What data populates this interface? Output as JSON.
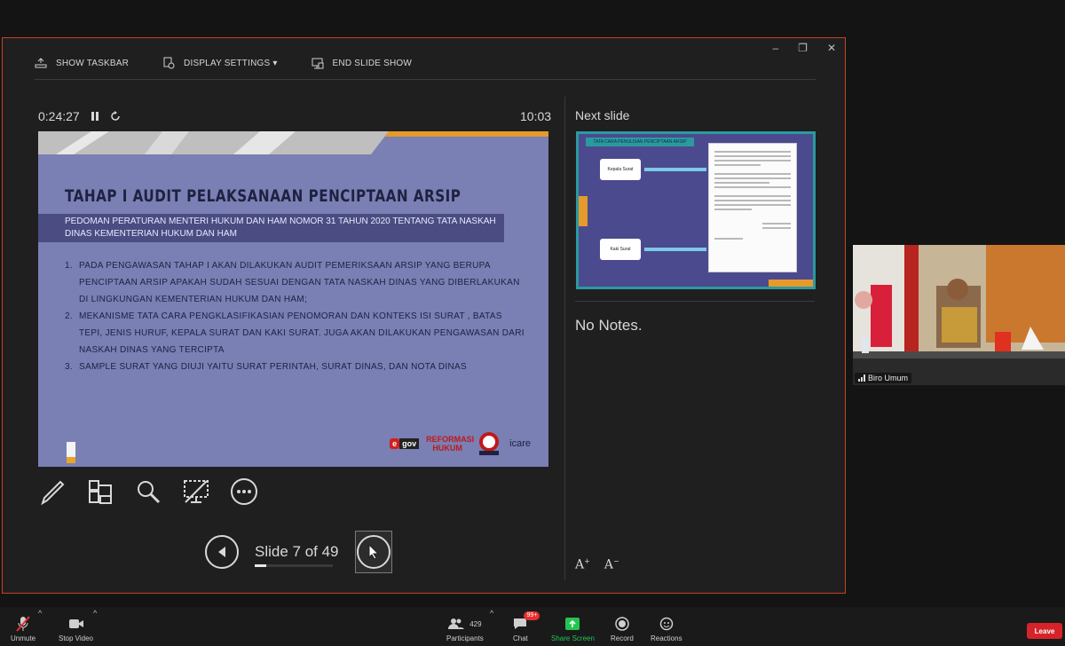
{
  "toolbar": {
    "show_taskbar": "SHOW TASKBAR",
    "display_settings": "DISPLAY SETTINGS ▾",
    "end_slide_show": "END SLIDE SHOW"
  },
  "window_controls": {
    "minimize": "–",
    "restore": "❐",
    "close": "✕"
  },
  "timer": {
    "elapsed": "0:24:27",
    "clock": "10:03"
  },
  "slide": {
    "title": "TAHAP I AUDIT PELAKSANAAN PENCIPTAAN ARSIP",
    "subtitle": "PEDOMAN PERATURAN MENTERI HUKUM DAN HAM NOMOR 31 TAHUN 2020 TENTANG TATA NASKAH DINAS KEMENTERIAN HUKUM DAN HAM",
    "items": [
      {
        "num": "1.",
        "text": "PADA PENGAWASAN TAHAP I AKAN DILAKUKAN AUDIT PEMERIKSAAN ARSIP YANG BERUPA PENCIPTAAN ARSIP APAKAH SUDAH SESUAI DENGAN TATA NASKAH DINAS YANG DIBERLAKUKAN DI LINGKUNGAN KEMENTERIAN HUKUM DAN HAM;"
      },
      {
        "num": "2.",
        "text": "MEKANISME TATA CARA PENGKLASIFIKASIAN PENOMORAN DAN KONTEKS ISI SURAT , BATAS TEPI, JENIS HURUF, KEPALA SURAT DAN KAKI SURAT. JUGA AKAN DILAKUKAN PENGAWASAN DARI NASKAH DINAS YANG TERCIPTA"
      },
      {
        "num": "3.",
        "text": "SAMPLE SURAT YANG DIUJI YAITU SURAT PERINTAH, SURAT DINAS, DAN NOTA DINAS"
      }
    ],
    "logos": {
      "egov_e": "e",
      "egov_gov": "gov",
      "reformasi": "REFORMASI HUKUM",
      "icare": "icare"
    }
  },
  "navigation": {
    "slide_counter": "Slide 7 of 49",
    "current": 7,
    "total": 49
  },
  "next_slide": {
    "label": "Next slide",
    "thumb_header": "TATA CARA PENULISAN PENCIPTAAN ARSIP",
    "box1": "Kepala Surat",
    "box2": "Kaki Surat"
  },
  "notes": "No Notes.",
  "font_buttons": {
    "increase": "A",
    "decrease": "A"
  },
  "video": {
    "participant_name": "Biro Umum"
  },
  "zoom_bar": {
    "unmute": "Unmute",
    "stop_video": "Stop Video",
    "participants": "Participants",
    "participants_count": "429",
    "chat": "Chat",
    "chat_badge": "99+",
    "share_screen": "Share Screen",
    "record": "Record",
    "reactions": "Reactions",
    "leave": "Leave"
  },
  "colors": {
    "accent_border": "#c4441f",
    "slide_bg": "#7a7fb4",
    "share_green": "#23c552",
    "leave_red": "#d6232a"
  }
}
